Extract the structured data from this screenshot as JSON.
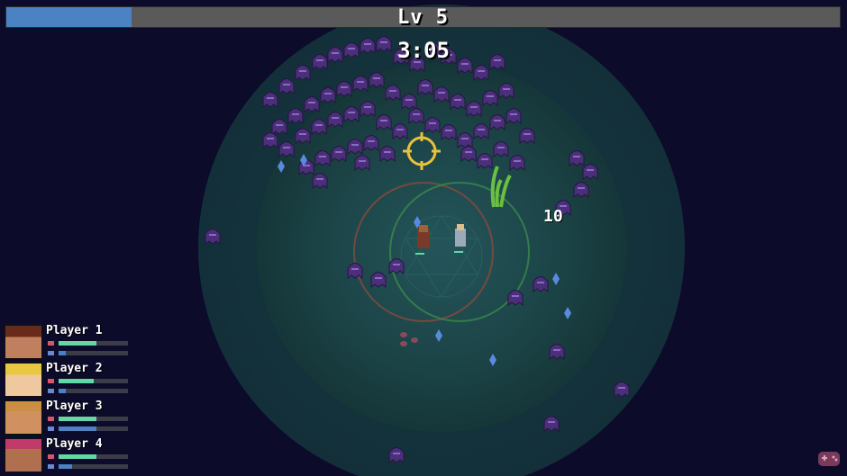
{
  "hud": {
    "level_label": "Lv 5",
    "xp_progress": 0.15,
    "timer": "3:05",
    "damage_popup": "10"
  },
  "players": [
    {
      "name": "Player 1",
      "health": 0.55,
      "mana": 0.1,
      "portrait": "portrait-player-1"
    },
    {
      "name": "Player 2",
      "health": 0.5,
      "mana": 0.1,
      "portrait": "portrait-player-2"
    },
    {
      "name": "Player 3",
      "health": 0.55,
      "mana": 0.55,
      "portrait": "portrait-player-3"
    },
    {
      "name": "Player 4",
      "health": 0.55,
      "mana": 0.2,
      "portrait": "portrait-player-4"
    }
  ],
  "colors": {
    "background": "#0d0b2a",
    "xp_fill": "#4a82c4",
    "health": "#66d6a4",
    "mana": "#4a82c4",
    "enemy": "#4b2f7a",
    "crosshair": "#e8c23a"
  },
  "icons": [
    "crosshair-icon",
    "heart-icon",
    "mana-icon",
    "gamepad-icon"
  ]
}
